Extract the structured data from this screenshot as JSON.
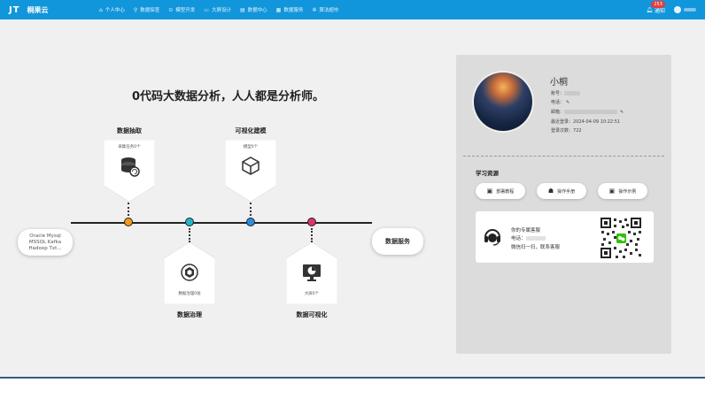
{
  "header": {
    "logo": "JT",
    "brand_name": "桐果云",
    "nav": [
      {
        "icon": "home-icon",
        "glyph": "⌂",
        "label": "个人中心",
        "active": true
      },
      {
        "icon": "search-icon",
        "glyph": "⚲",
        "label": "数据探查"
      },
      {
        "icon": "model-icon",
        "glyph": "⊙",
        "label": "模型开发"
      },
      {
        "icon": "monitor-icon",
        "glyph": "▭",
        "label": "大屏设计"
      },
      {
        "icon": "data-center-icon",
        "glyph": "▤",
        "label": "数据中心"
      },
      {
        "icon": "data-service-icon",
        "glyph": "▦",
        "label": "数据服务"
      },
      {
        "icon": "algorithm-icon",
        "glyph": "✲",
        "label": "算法超市"
      }
    ],
    "notification_label": "通知",
    "notification_count": "253"
  },
  "main": {
    "slogan": "0代码大数据分析，人人都是分析师。",
    "source_lines": [
      "Oracle Mysql",
      "MSSQL Kafka",
      "Hadoop Txt..."
    ],
    "service_label": "数据服务",
    "steps": {
      "extract": {
        "title": "数据抽取",
        "sub": "采集任务0个",
        "icon": "database-sync-icon"
      },
      "govern": {
        "title": "数据治理",
        "sub": "数据治理0张",
        "icon": "governance-icon"
      },
      "modeling": {
        "title": "可视化建模",
        "sub": "模型0个",
        "icon": "cube-icon"
      },
      "visual": {
        "title": "数据可视化",
        "sub": "大屏0个",
        "icon": "dashboard-icon"
      }
    }
  },
  "profile": {
    "name": "小桐",
    "account_label": "账号：",
    "phone_label": "电话：",
    "email_label": "邮箱：",
    "last_login_label": "最近登录：",
    "last_login_value": "2024-04-09 10:22:51",
    "login_count_label": "登录次数：",
    "login_count_value": "722"
  },
  "resources": {
    "title": "学习资源",
    "buttons": [
      {
        "label": "部署教程",
        "icon": "book-icon",
        "glyph": "▣"
      },
      {
        "label": "操作手册",
        "icon": "user-guide-icon",
        "glyph": "☗"
      },
      {
        "label": "操作示例",
        "icon": "video-icon",
        "glyph": "▣"
      }
    ],
    "contact": {
      "title": "你的专属客服",
      "phone_label": "电话：",
      "hours": "微信扫一扫，联系客服"
    }
  },
  "colors": {
    "header_bg": "#1296db",
    "node_orange": "#f39c12",
    "node_teal": "#22b5cc",
    "node_blue": "#2b8fe0",
    "node_pink": "#e03468"
  }
}
